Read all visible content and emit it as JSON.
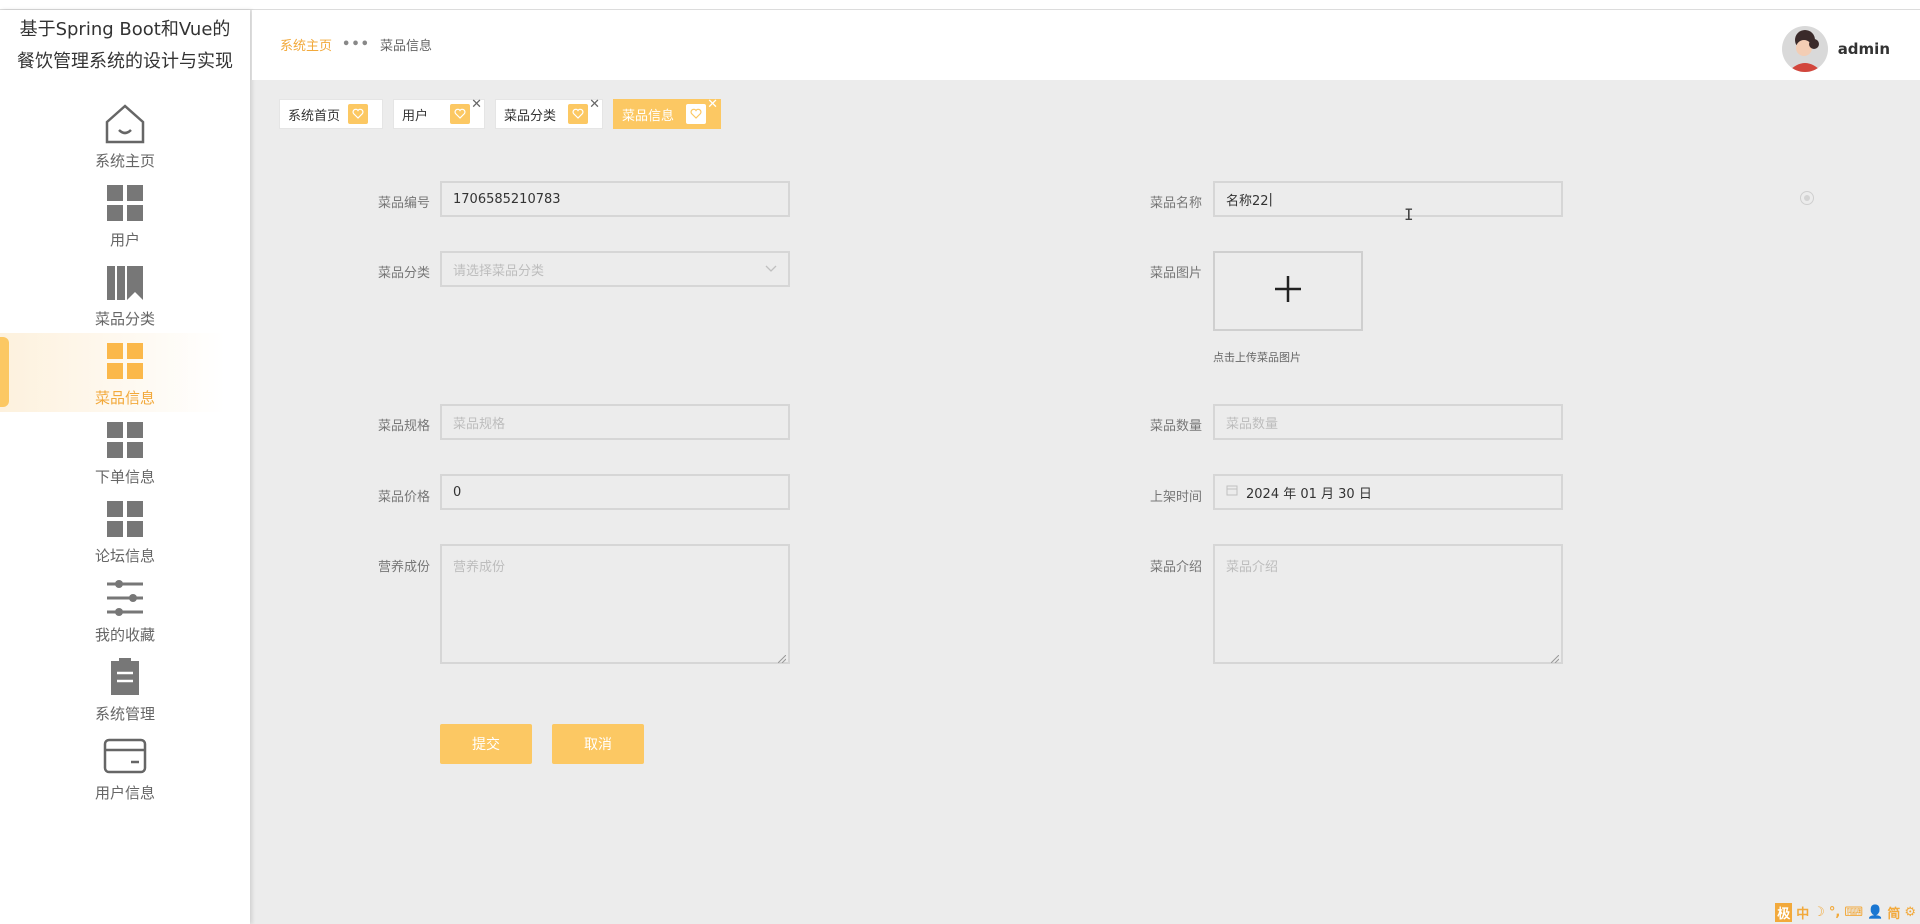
{
  "app": {
    "title": "基于Spring Boot和Vue的餐饮管理系统的设计与实现"
  },
  "sidebar": {
    "items": [
      {
        "label": "系统主页",
        "icon": "home-icon"
      },
      {
        "label": "用户",
        "icon": "grid-icon"
      },
      {
        "label": "菜品分类",
        "icon": "bookshelf-icon"
      },
      {
        "label": "菜品信息",
        "icon": "grid-icon",
        "active": true
      },
      {
        "label": "下单信息",
        "icon": "grid-icon"
      },
      {
        "label": "论坛信息",
        "icon": "grid-icon"
      },
      {
        "label": "我的收藏",
        "icon": "sliders-icon"
      },
      {
        "label": "系统管理",
        "icon": "clipboard-icon"
      },
      {
        "label": "用户信息",
        "icon": "card-icon"
      }
    ]
  },
  "header": {
    "breadcrumb": {
      "home": "系统主页",
      "separator": "•••",
      "current": "菜品信息"
    },
    "user": {
      "name": "admin"
    }
  },
  "tabs": [
    {
      "label": "系统首页",
      "closable": false
    },
    {
      "label": "用户",
      "closable": true
    },
    {
      "label": "菜品分类",
      "closable": true
    },
    {
      "label": "菜品信息",
      "closable": true,
      "active": true
    }
  ],
  "form": {
    "dish_code": {
      "label": "菜品编号",
      "value": "1706585210783"
    },
    "dish_name": {
      "label": "菜品名称",
      "value": "名称22"
    },
    "dish_category": {
      "label": "菜品分类",
      "placeholder": "请选择菜品分类"
    },
    "dish_image": {
      "label": "菜品图片",
      "tip": "点击上传菜品图片"
    },
    "dish_spec": {
      "label": "菜品规格",
      "placeholder": "菜品规格"
    },
    "dish_quantity": {
      "label": "菜品数量",
      "placeholder": "菜品数量"
    },
    "dish_price": {
      "label": "菜品价格",
      "value": "0"
    },
    "listing_time": {
      "label": "上架时间",
      "value": "2024 年 01 月 30 日"
    },
    "nutrition": {
      "label": "营养成份",
      "placeholder": "营养成份"
    },
    "description": {
      "label": "菜品介绍",
      "placeholder": "菜品介绍"
    },
    "submit_label": "提交",
    "cancel_label": "取消"
  },
  "ime": {
    "items": [
      "极",
      "中",
      "☽",
      "°,",
      "⌨",
      "👤",
      "简",
      "⚙"
    ]
  },
  "colors": {
    "accent": "#fcc863",
    "accent_text": "#f2a93b",
    "background": "#ececec"
  }
}
